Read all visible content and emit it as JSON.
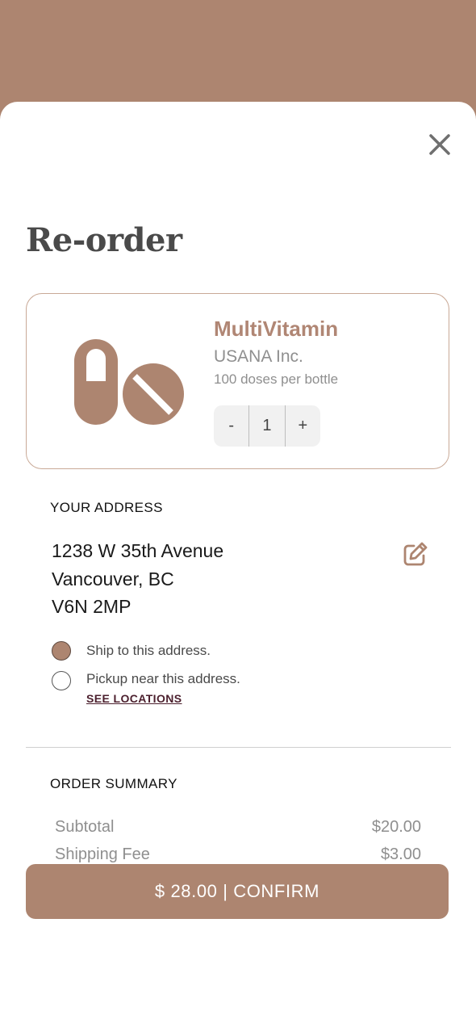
{
  "colors": {
    "accent": "#ad8570",
    "link": "#4b1f2d",
    "text_dark": "#4a4a4a"
  },
  "title": "Re-order",
  "close_icon": "close-icon",
  "product": {
    "icon": "pills-icon",
    "name": "MultiVitamin",
    "manufacturer": "USANA Inc.",
    "doses": "100 doses per bottle",
    "quantity": {
      "minus": "-",
      "value": "1",
      "plus": "+"
    }
  },
  "address": {
    "heading": "YOUR ADDRESS",
    "line1": "1238 W 35th Avenue",
    "line2": "Vancouver, BC",
    "line3": "V6N 2MP",
    "edit_icon": "edit-icon",
    "options": [
      {
        "label": "Ship to this address.",
        "selected": true
      },
      {
        "label": "Pickup near this address.",
        "selected": false
      }
    ],
    "see_locations": "SEE LOCATIONS"
  },
  "summary": {
    "heading": "ORDER SUMMARY",
    "rows": [
      {
        "label": "Subtotal",
        "value": "$20.00"
      },
      {
        "label": "Shipping Fee",
        "value": "$3.00"
      }
    ]
  },
  "confirm": {
    "label": "$ 28.00 | CONFIRM"
  }
}
